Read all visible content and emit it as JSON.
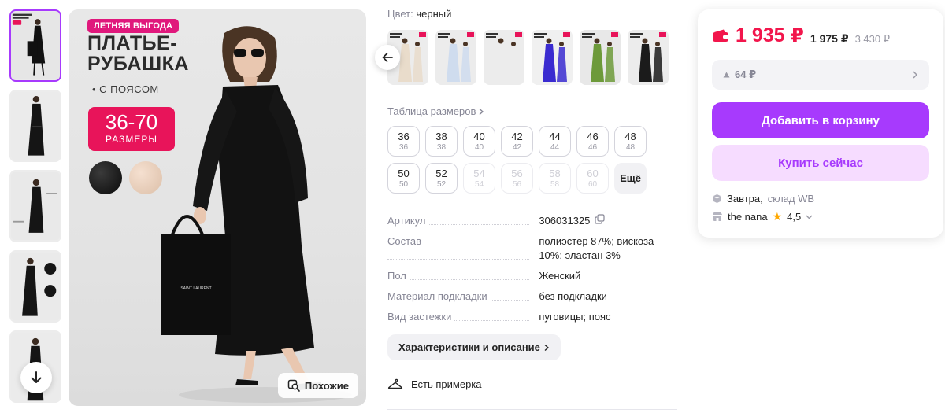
{
  "gallery": {
    "thumbnails_count": 5,
    "active_index": 0,
    "down_icon": "arrow-down-icon"
  },
  "main_image": {
    "promo_badge": "ЛЕТНЯЯ ВЫГОДА",
    "title": "ПЛАТЬЕ-РУБАШКА",
    "bullet": "• С ПОЯСОМ",
    "size_range": "36-70",
    "size_range_label": "РАЗМЕРЫ",
    "bag_text": "SAINT LAURENT",
    "similar_label": "Похожие",
    "swatch_colors": [
      "#111111",
      "#e9cdb8"
    ]
  },
  "color": {
    "label": "Цвет:",
    "value": "черный",
    "variant_colors": [
      "#e9dccb",
      "#cfdcee",
      "#ececec",
      "#3a2bd0",
      "#6d9a3a",
      "#1b1b1b"
    ]
  },
  "sizes": {
    "table_link": "Таблица размеров",
    "items": [
      {
        "ru": "36",
        "eu": "36",
        "available": true
      },
      {
        "ru": "38",
        "eu": "38",
        "available": true
      },
      {
        "ru": "40",
        "eu": "40",
        "available": true
      },
      {
        "ru": "42",
        "eu": "42",
        "available": true
      },
      {
        "ru": "44",
        "eu": "44",
        "available": true
      },
      {
        "ru": "46",
        "eu": "46",
        "available": true
      },
      {
        "ru": "48",
        "eu": "48",
        "available": true
      },
      {
        "ru": "50",
        "eu": "50",
        "available": true
      },
      {
        "ru": "52",
        "eu": "52",
        "available": true
      },
      {
        "ru": "54",
        "eu": "54",
        "available": false
      },
      {
        "ru": "56",
        "eu": "56",
        "available": false
      },
      {
        "ru": "58",
        "eu": "58",
        "available": false
      },
      {
        "ru": "60",
        "eu": "60",
        "available": false
      }
    ],
    "more_label": "Ещё"
  },
  "params": [
    {
      "key": "Артикул",
      "value": "306031325",
      "copy": true
    },
    {
      "key": "Состав",
      "value": "полиэстер 87%; вискоза 10%; эластан 3%"
    },
    {
      "key": "Пол",
      "value": "Женский"
    },
    {
      "key": "Материал подкладки",
      "value": "без подкладки"
    },
    {
      "key": "Вид застежки",
      "value": "пуговицы; пояс"
    }
  ],
  "details_button": "Характеристики и описание",
  "fitting": "Есть примерка",
  "buy": {
    "price_now": "1 935 ₽",
    "price_mid": "1 975 ₽",
    "price_old": "3 430 ₽",
    "bonus": "64 ₽",
    "add_to_cart": "Добавить в корзину",
    "buy_now": "Купить сейчас",
    "delivery_when": "Завтра,",
    "delivery_where": "склад WB",
    "seller": "the nana",
    "rating": "4,5",
    "accent_color": "#a73afd",
    "price_color": "#f2164c"
  }
}
